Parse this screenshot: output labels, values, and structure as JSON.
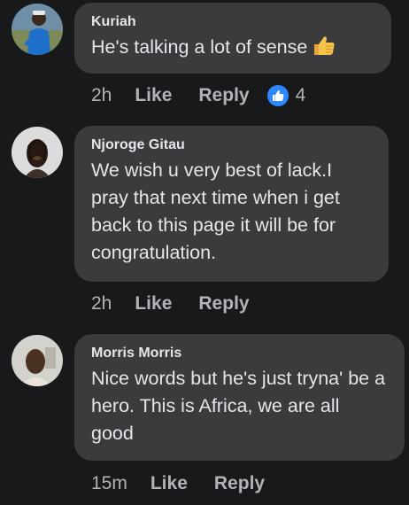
{
  "comments": [
    {
      "author": "Kuriah",
      "text": "He's talking a lot of sense",
      "emoji": "thumbs-up-emoji",
      "time": "2h",
      "like_label": "Like",
      "reply_label": "Reply",
      "reaction_count": "4",
      "reaction_icon": "like-reaction-icon"
    },
    {
      "author": "Njoroge Gitau",
      "text": "We wish u very best of lack.I pray that next time when i get back to this page it will be for congratulation.",
      "time": "2h",
      "like_label": "Like",
      "reply_label": "Reply"
    },
    {
      "author": "Morris Morris",
      "text": "Nice words but he's just tryna' be a hero. This is Africa, we are all good",
      "time": "15m",
      "like_label": "Like",
      "reply_label": "Reply"
    }
  ],
  "colors": {
    "background": "#18191a",
    "bubble": "#3a3b3c",
    "text": "#e4e6eb",
    "secondary_text": "#b0b3b8",
    "reaction_blue": "#2d88ff"
  }
}
